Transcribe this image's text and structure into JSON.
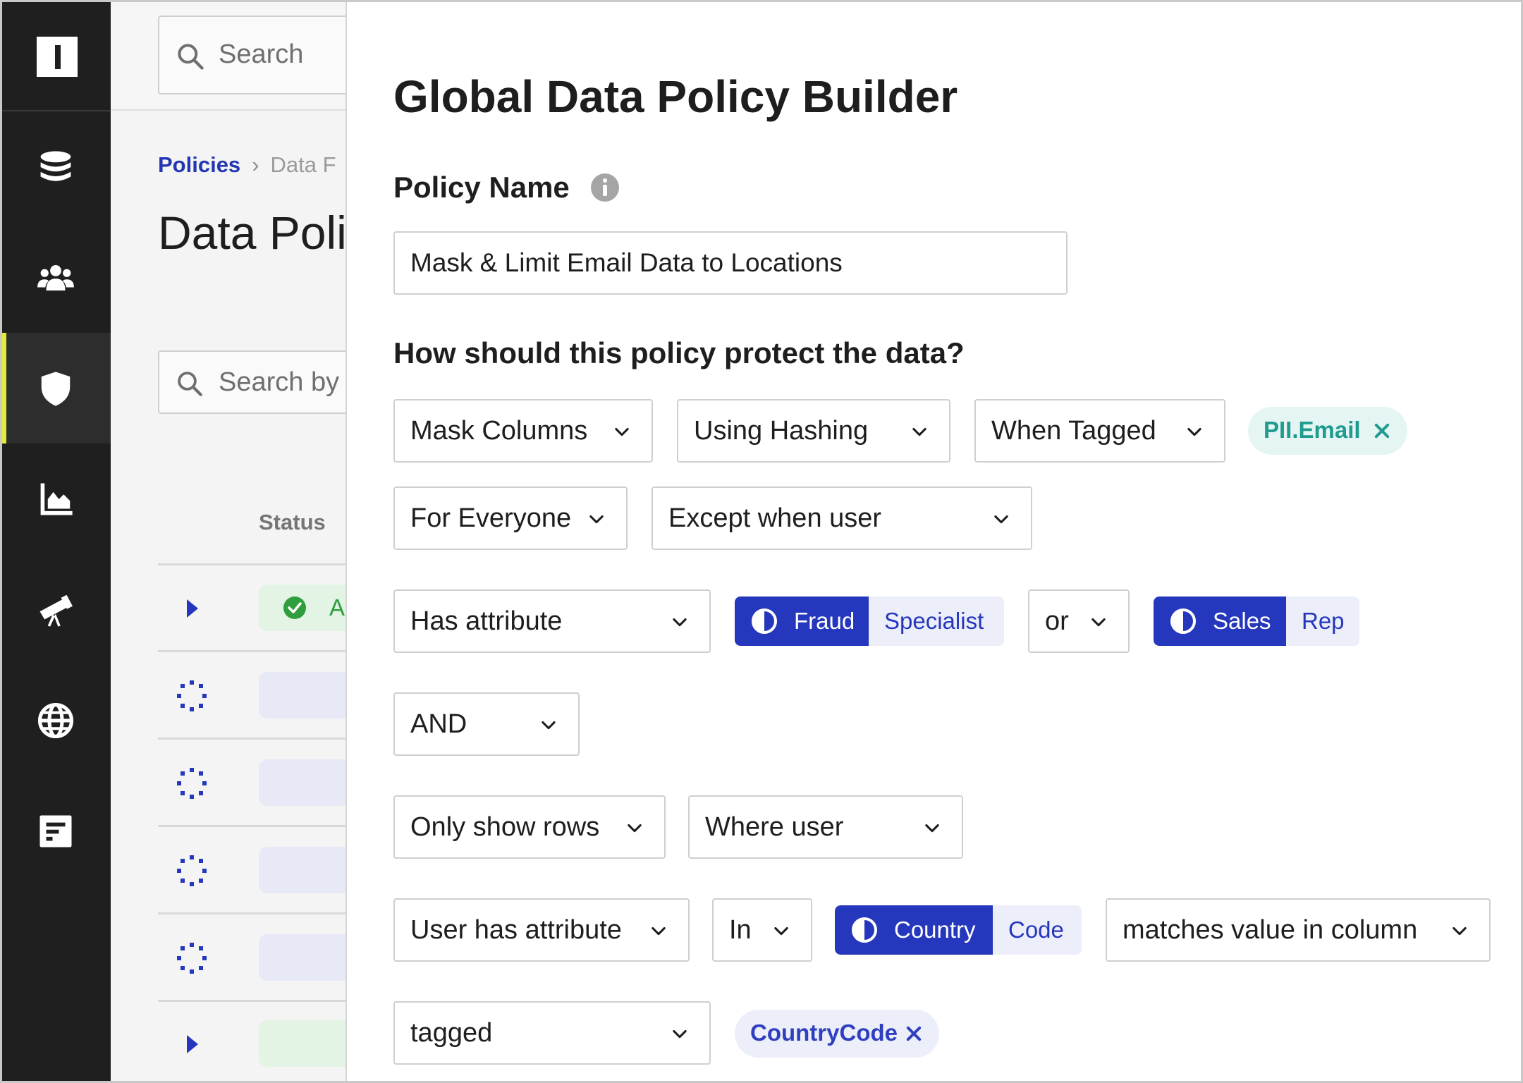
{
  "colors": {
    "sidebar_bg": "#1f1f1f",
    "accent_active": "#e6ea3a",
    "primary_blue": "#2537bc",
    "teal": "#1f9b8f",
    "success_green": "#2f9e3e"
  },
  "sidebar": {
    "logo_icon": "logo-icon",
    "items": [
      {
        "icon": "database-icon"
      },
      {
        "icon": "users-icon"
      },
      {
        "icon": "shield-icon",
        "active": true
      },
      {
        "icon": "chart-icon"
      },
      {
        "icon": "telescope-icon"
      },
      {
        "icon": "globe-icon"
      },
      {
        "icon": "report-icon"
      }
    ]
  },
  "background_page": {
    "search_placeholder": "Search",
    "breadcrumb": {
      "root": "Policies",
      "current": "Data F"
    },
    "title": "Data Poli",
    "table_search_placeholder": "Search by r",
    "status_header": "Status",
    "first_status": "Ac"
  },
  "modal": {
    "title": "Global Data Policy Builder",
    "policy_name_label": "Policy Name",
    "policy_name_value": "Mask & Limit Email Data to Locations",
    "question": "How should this policy protect the data?",
    "row1": {
      "action": "Mask Columns",
      "method": "Using Hashing",
      "condition": "When Tagged",
      "tag": "PII.Email"
    },
    "row2": {
      "scope": "For Everyone",
      "exception": "Except when user"
    },
    "row3": {
      "predicate": "Has attribute",
      "attr1": {
        "key": "Fraud",
        "value": "Specialist"
      },
      "operator": "or",
      "attr2": {
        "key": "Sales",
        "value": "Rep"
      }
    },
    "row4": {
      "conjunction": "AND"
    },
    "row5": {
      "rows_action": "Only show rows",
      "rows_condition": "Where user"
    },
    "row6": {
      "predicate": "User has attribute",
      "operator": "In",
      "attr": {
        "key": "Country",
        "value": "Code"
      },
      "match": "matches value in column"
    },
    "row7": {
      "predicate": "tagged",
      "tag": "CountryCode"
    }
  }
}
